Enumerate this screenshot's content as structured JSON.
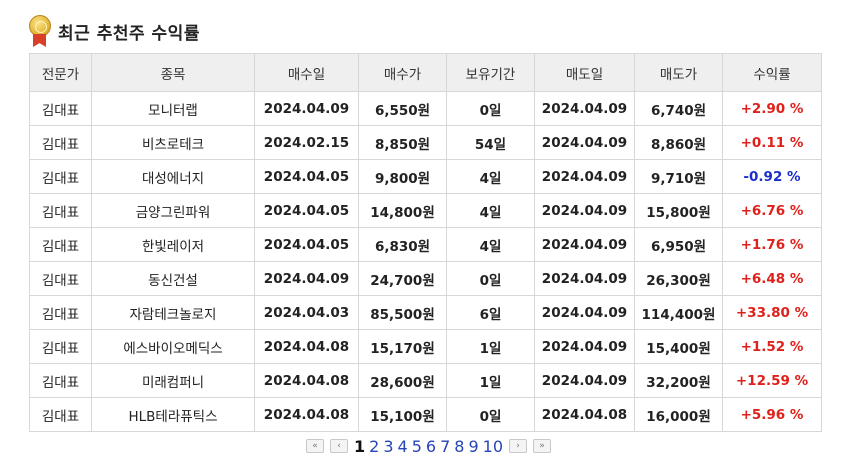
{
  "header": {
    "title": "최근 추천주 수익률"
  },
  "colors": {
    "positive": "#e0201a",
    "negative": "#1a2ec9",
    "header_bg": "#efefef"
  },
  "table": {
    "columns": [
      "전문가",
      "종목",
      "매수일",
      "매수가",
      "보유기간",
      "매도일",
      "매도가",
      "수익률"
    ],
    "rows": [
      {
        "expert": "김대표",
        "stock": "모니터랩",
        "buy_date": "2024.04.09",
        "buy_price": "6,550원",
        "period": "0일",
        "sell_date": "2024.04.09",
        "sell_price": "6,740원",
        "return": "+2.90 %",
        "sign": "pos"
      },
      {
        "expert": "김대표",
        "stock": "비츠로테크",
        "buy_date": "2024.02.15",
        "buy_price": "8,850원",
        "period": "54일",
        "sell_date": "2024.04.09",
        "sell_price": "8,860원",
        "return": "+0.11 %",
        "sign": "pos"
      },
      {
        "expert": "김대표",
        "stock": "대성에너지",
        "buy_date": "2024.04.05",
        "buy_price": "9,800원",
        "period": "4일",
        "sell_date": "2024.04.09",
        "sell_price": "9,710원",
        "return": "-0.92 %",
        "sign": "neg"
      },
      {
        "expert": "김대표",
        "stock": "금양그린파워",
        "buy_date": "2024.04.05",
        "buy_price": "14,800원",
        "period": "4일",
        "sell_date": "2024.04.09",
        "sell_price": "15,800원",
        "return": "+6.76 %",
        "sign": "pos"
      },
      {
        "expert": "김대표",
        "stock": "한빛레이저",
        "buy_date": "2024.04.05",
        "buy_price": "6,830원",
        "period": "4일",
        "sell_date": "2024.04.09",
        "sell_price": "6,950원",
        "return": "+1.76 %",
        "sign": "pos"
      },
      {
        "expert": "김대표",
        "stock": "동신건설",
        "buy_date": "2024.04.09",
        "buy_price": "24,700원",
        "period": "0일",
        "sell_date": "2024.04.09",
        "sell_price": "26,300원",
        "return": "+6.48 %",
        "sign": "pos"
      },
      {
        "expert": "김대표",
        "stock": "자람테크놀로지",
        "buy_date": "2024.04.03",
        "buy_price": "85,500원",
        "period": "6일",
        "sell_date": "2024.04.09",
        "sell_price": "114,400원",
        "return": "+33.80 %",
        "sign": "pos"
      },
      {
        "expert": "김대표",
        "stock": "에스바이오메딕스",
        "buy_date": "2024.04.08",
        "buy_price": "15,170원",
        "period": "1일",
        "sell_date": "2024.04.09",
        "sell_price": "15,400원",
        "return": "+1.52 %",
        "sign": "pos"
      },
      {
        "expert": "김대표",
        "stock": "미래컴퍼니",
        "buy_date": "2024.04.08",
        "buy_price": "28,600원",
        "period": "1일",
        "sell_date": "2024.04.09",
        "sell_price": "32,200원",
        "return": "+12.59 %",
        "sign": "pos"
      },
      {
        "expert": "김대표",
        "stock": "HLB테라퓨틱스",
        "buy_date": "2024.04.08",
        "buy_price": "15,100원",
        "period": "0일",
        "sell_date": "2024.04.08",
        "sell_price": "16,000원",
        "return": "+5.96 %",
        "sign": "pos"
      }
    ]
  },
  "pagination": {
    "first": "«",
    "prev": "‹",
    "next": "›",
    "last": "»",
    "current": "1",
    "pages": [
      "1",
      "2",
      "3",
      "4",
      "5",
      "6",
      "7",
      "8",
      "9",
      "10"
    ]
  }
}
